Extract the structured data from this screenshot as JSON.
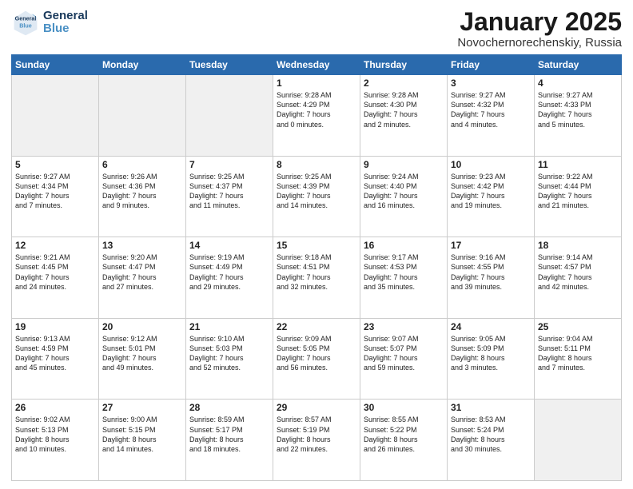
{
  "logo": {
    "line1": "General",
    "line2": "Blue"
  },
  "title": "January 2025",
  "location": "Novochernorechenskiy, Russia",
  "weekdays": [
    "Sunday",
    "Monday",
    "Tuesday",
    "Wednesday",
    "Thursday",
    "Friday",
    "Saturday"
  ],
  "weeks": [
    [
      {
        "day": "",
        "info": ""
      },
      {
        "day": "",
        "info": ""
      },
      {
        "day": "",
        "info": ""
      },
      {
        "day": "1",
        "info": "Sunrise: 9:28 AM\nSunset: 4:29 PM\nDaylight: 7 hours\nand 0 minutes."
      },
      {
        "day": "2",
        "info": "Sunrise: 9:28 AM\nSunset: 4:30 PM\nDaylight: 7 hours\nand 2 minutes."
      },
      {
        "day": "3",
        "info": "Sunrise: 9:27 AM\nSunset: 4:32 PM\nDaylight: 7 hours\nand 4 minutes."
      },
      {
        "day": "4",
        "info": "Sunrise: 9:27 AM\nSunset: 4:33 PM\nDaylight: 7 hours\nand 5 minutes."
      }
    ],
    [
      {
        "day": "5",
        "info": "Sunrise: 9:27 AM\nSunset: 4:34 PM\nDaylight: 7 hours\nand 7 minutes."
      },
      {
        "day": "6",
        "info": "Sunrise: 9:26 AM\nSunset: 4:36 PM\nDaylight: 7 hours\nand 9 minutes."
      },
      {
        "day": "7",
        "info": "Sunrise: 9:25 AM\nSunset: 4:37 PM\nDaylight: 7 hours\nand 11 minutes."
      },
      {
        "day": "8",
        "info": "Sunrise: 9:25 AM\nSunset: 4:39 PM\nDaylight: 7 hours\nand 14 minutes."
      },
      {
        "day": "9",
        "info": "Sunrise: 9:24 AM\nSunset: 4:40 PM\nDaylight: 7 hours\nand 16 minutes."
      },
      {
        "day": "10",
        "info": "Sunrise: 9:23 AM\nSunset: 4:42 PM\nDaylight: 7 hours\nand 19 minutes."
      },
      {
        "day": "11",
        "info": "Sunrise: 9:22 AM\nSunset: 4:44 PM\nDaylight: 7 hours\nand 21 minutes."
      }
    ],
    [
      {
        "day": "12",
        "info": "Sunrise: 9:21 AM\nSunset: 4:45 PM\nDaylight: 7 hours\nand 24 minutes."
      },
      {
        "day": "13",
        "info": "Sunrise: 9:20 AM\nSunset: 4:47 PM\nDaylight: 7 hours\nand 27 minutes."
      },
      {
        "day": "14",
        "info": "Sunrise: 9:19 AM\nSunset: 4:49 PM\nDaylight: 7 hours\nand 29 minutes."
      },
      {
        "day": "15",
        "info": "Sunrise: 9:18 AM\nSunset: 4:51 PM\nDaylight: 7 hours\nand 32 minutes."
      },
      {
        "day": "16",
        "info": "Sunrise: 9:17 AM\nSunset: 4:53 PM\nDaylight: 7 hours\nand 35 minutes."
      },
      {
        "day": "17",
        "info": "Sunrise: 9:16 AM\nSunset: 4:55 PM\nDaylight: 7 hours\nand 39 minutes."
      },
      {
        "day": "18",
        "info": "Sunrise: 9:14 AM\nSunset: 4:57 PM\nDaylight: 7 hours\nand 42 minutes."
      }
    ],
    [
      {
        "day": "19",
        "info": "Sunrise: 9:13 AM\nSunset: 4:59 PM\nDaylight: 7 hours\nand 45 minutes."
      },
      {
        "day": "20",
        "info": "Sunrise: 9:12 AM\nSunset: 5:01 PM\nDaylight: 7 hours\nand 49 minutes."
      },
      {
        "day": "21",
        "info": "Sunrise: 9:10 AM\nSunset: 5:03 PM\nDaylight: 7 hours\nand 52 minutes."
      },
      {
        "day": "22",
        "info": "Sunrise: 9:09 AM\nSunset: 5:05 PM\nDaylight: 7 hours\nand 56 minutes."
      },
      {
        "day": "23",
        "info": "Sunrise: 9:07 AM\nSunset: 5:07 PM\nDaylight: 7 hours\nand 59 minutes."
      },
      {
        "day": "24",
        "info": "Sunrise: 9:05 AM\nSunset: 5:09 PM\nDaylight: 8 hours\nand 3 minutes."
      },
      {
        "day": "25",
        "info": "Sunrise: 9:04 AM\nSunset: 5:11 PM\nDaylight: 8 hours\nand 7 minutes."
      }
    ],
    [
      {
        "day": "26",
        "info": "Sunrise: 9:02 AM\nSunset: 5:13 PM\nDaylight: 8 hours\nand 10 minutes."
      },
      {
        "day": "27",
        "info": "Sunrise: 9:00 AM\nSunset: 5:15 PM\nDaylight: 8 hours\nand 14 minutes."
      },
      {
        "day": "28",
        "info": "Sunrise: 8:59 AM\nSunset: 5:17 PM\nDaylight: 8 hours\nand 18 minutes."
      },
      {
        "day": "29",
        "info": "Sunrise: 8:57 AM\nSunset: 5:19 PM\nDaylight: 8 hours\nand 22 minutes."
      },
      {
        "day": "30",
        "info": "Sunrise: 8:55 AM\nSunset: 5:22 PM\nDaylight: 8 hours\nand 26 minutes."
      },
      {
        "day": "31",
        "info": "Sunrise: 8:53 AM\nSunset: 5:24 PM\nDaylight: 8 hours\nand 30 minutes."
      },
      {
        "day": "",
        "info": ""
      }
    ]
  ]
}
